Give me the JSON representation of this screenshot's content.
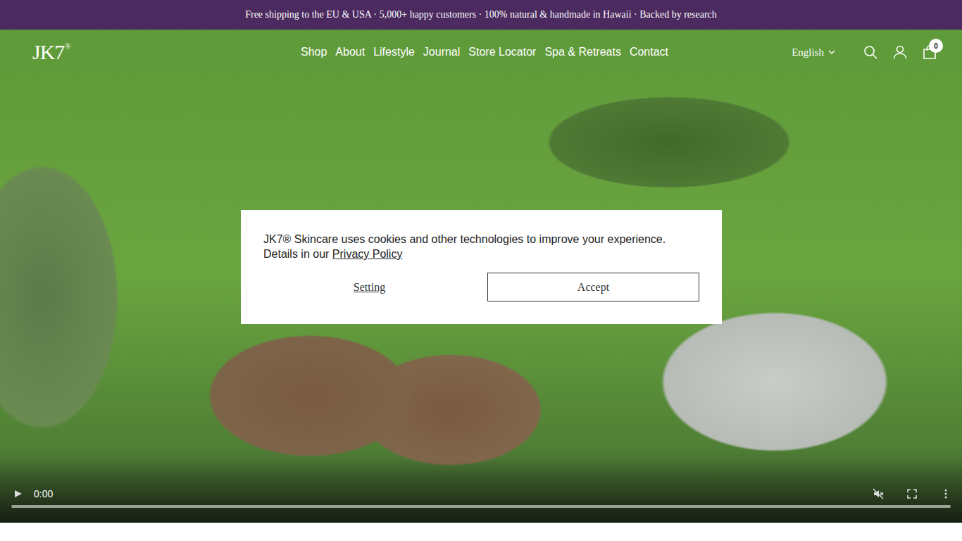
{
  "announcement": "Free shipping to the EU & USA · 5,000+ happy customers · 100% natural & handmade in Hawaii · Backed by research",
  "header": {
    "logo": "JK7",
    "logo_mark": "®",
    "nav": [
      "Shop",
      "About",
      "Lifestyle",
      "Journal",
      "Store Locator",
      "Spa & Retreats",
      "Contact"
    ],
    "language": "English",
    "cart_count": "0"
  },
  "video": {
    "time": "0:00",
    "muted": true
  },
  "cookie": {
    "message": "JK7® Skincare uses cookies and other technologies to improve your experience.",
    "details": "Details in our ",
    "link": "Privacy Policy",
    "buttons": [
      "Setting",
      "Accept"
    ]
  }
}
